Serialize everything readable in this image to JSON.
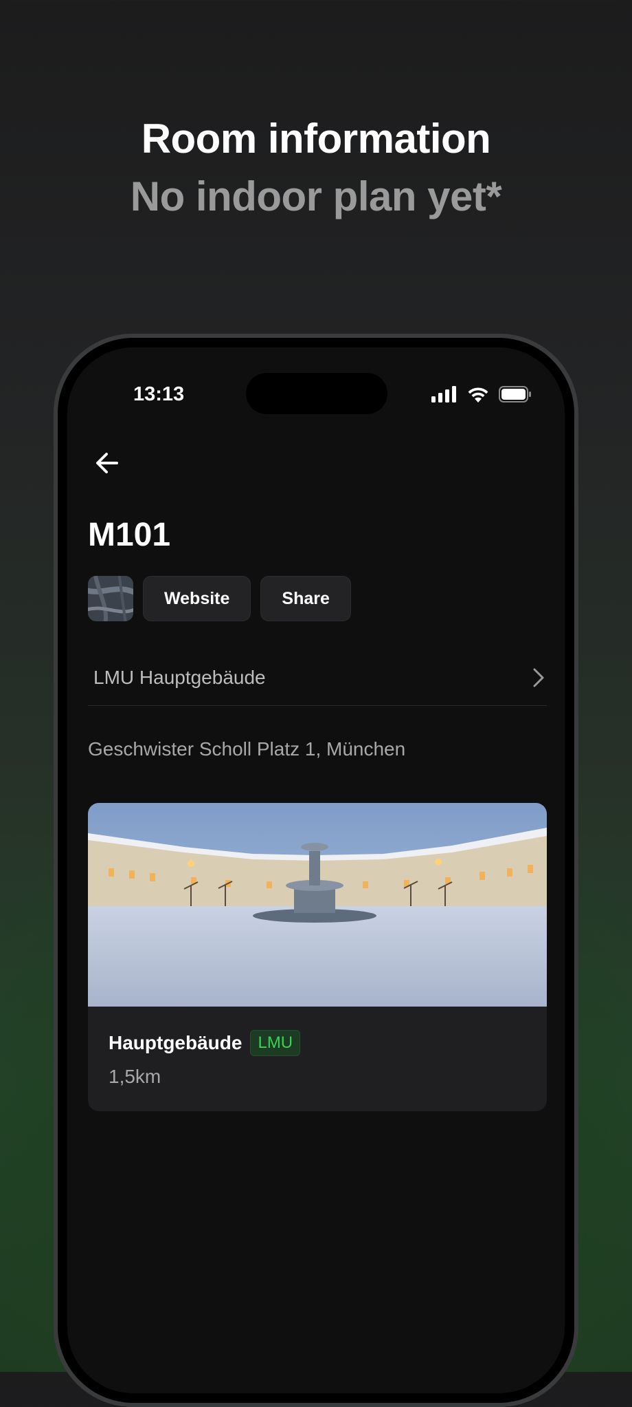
{
  "promo": {
    "title": "Room information",
    "subtitle": "No indoor plan yet*"
  },
  "status_bar": {
    "time": "13:13",
    "icons": [
      "signal-icon",
      "wifi-icon",
      "battery-icon"
    ]
  },
  "room": {
    "name": "M101",
    "actions": {
      "website_label": "Website",
      "share_label": "Share"
    },
    "building_link": "LMU Hauptgebäude",
    "address": "Geschwister Scholl Platz 1, München"
  },
  "card": {
    "title": "Hauptgebäude",
    "badge": "LMU",
    "distance": "1,5km"
  },
  "colors": {
    "accent_green": "#3ad05a",
    "screen_bg": "#0f0f10",
    "card_bg": "#1f1f21"
  }
}
